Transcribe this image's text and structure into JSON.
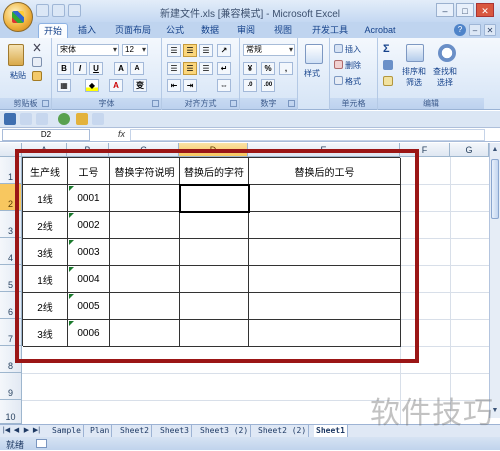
{
  "window": {
    "title": "新建文件.xls [兼容模式] - Microsoft Excel",
    "min_label": "–",
    "max_label": "□",
    "close_label": "✕"
  },
  "tabs": [
    "开始",
    "插入",
    "页面布局",
    "公式",
    "数据",
    "审阅",
    "视图",
    "开发工具",
    "Acrobat"
  ],
  "ribbon": {
    "clipboard": {
      "paste_label": "粘贴",
      "group_label": "剪贴板"
    },
    "font": {
      "font_name": "宋体",
      "font_size": "12",
      "bold": "B",
      "italic": "I",
      "underline": "U",
      "grow": "A",
      "shrink": "A",
      "phonetic": "变",
      "group_label": "字体"
    },
    "alignment": {
      "group_label": "对齐方式"
    },
    "number": {
      "format": "常规",
      "percent": "%",
      "comma": ",",
      "group_label": "数字"
    },
    "styles": {
      "styles_label": "样式"
    },
    "cells": {
      "insert_label": "插入",
      "delete_label": "删除",
      "format_label": "格式",
      "group_label": "单元格"
    },
    "editing": {
      "sigma": "Σ",
      "sort_label": "排序和\n筛选",
      "find_label": "查找和\n选择",
      "group_label": "编辑"
    }
  },
  "formula_bar": {
    "name_box": "D2",
    "fx": "fx",
    "value": ""
  },
  "columns": [
    "A",
    "B",
    "C",
    "D",
    "E",
    "F",
    "G"
  ],
  "rows": [
    "1",
    "2",
    "3",
    "4",
    "5",
    "6",
    "7",
    "8",
    "9",
    "10"
  ],
  "table": {
    "headers": [
      "生产线",
      "工号",
      "替换字符说明",
      "替换后的字符",
      "替换后的工号"
    ],
    "rows": [
      [
        "1线",
        "0001",
        "",
        "",
        ""
      ],
      [
        "2线",
        "0002",
        "",
        "",
        ""
      ],
      [
        "3线",
        "0003",
        "",
        "",
        ""
      ],
      [
        "1线",
        "0004",
        "",
        "",
        ""
      ],
      [
        "2线",
        "0005",
        "",
        "",
        ""
      ],
      [
        "3线",
        "0006",
        "",
        "",
        ""
      ]
    ]
  },
  "sheets": [
    "Sample",
    "Plan",
    "Sheet2",
    "Sheet3",
    "Sheet3 (2)",
    "Sheet2 (2)",
    "Sheet1"
  ],
  "active_sheet": "Sheet1",
  "status": {
    "ready": "就绪"
  },
  "watermark": "软件技巧",
  "colors": {
    "frame": "#9b1616",
    "selected_header": "#f8c75f"
  }
}
